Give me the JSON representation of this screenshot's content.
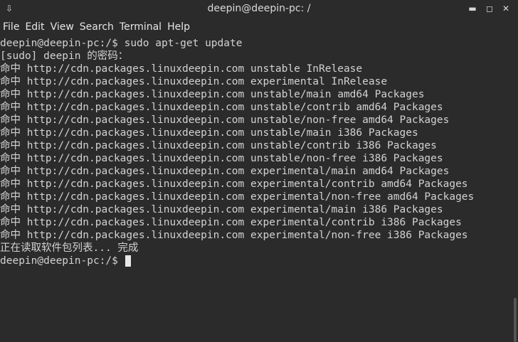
{
  "window": {
    "title": "deepin@deepin-pc: /",
    "menu_icon": "⇩",
    "min_glyph": "▬",
    "max_glyph": "◻",
    "close_glyph": "✕"
  },
  "menubar": {
    "items": [
      "File",
      "Edit",
      "View",
      "Search",
      "Terminal",
      "Help"
    ]
  },
  "terminal": {
    "lines": [
      "deepin@deepin-pc:/$ sudo apt-get update",
      "[sudo] deepin 的密码：",
      "命中 http://cdn.packages.linuxdeepin.com unstable InRelease",
      "命中 http://cdn.packages.linuxdeepin.com experimental InRelease",
      "命中 http://cdn.packages.linuxdeepin.com unstable/main amd64 Packages",
      "命中 http://cdn.packages.linuxdeepin.com unstable/contrib amd64 Packages",
      "命中 http://cdn.packages.linuxdeepin.com unstable/non-free amd64 Packages",
      "命中 http://cdn.packages.linuxdeepin.com unstable/main i386 Packages",
      "命中 http://cdn.packages.linuxdeepin.com unstable/contrib i386 Packages",
      "命中 http://cdn.packages.linuxdeepin.com unstable/non-free i386 Packages",
      "命中 http://cdn.packages.linuxdeepin.com experimental/main amd64 Packages",
      "命中 http://cdn.packages.linuxdeepin.com experimental/contrib amd64 Packages",
      "命中 http://cdn.packages.linuxdeepin.com experimental/non-free amd64 Packages",
      "命中 http://cdn.packages.linuxdeepin.com experimental/main i386 Packages",
      "命中 http://cdn.packages.linuxdeepin.com experimental/contrib i386 Packages",
      "命中 http://cdn.packages.linuxdeepin.com experimental/non-free i386 Packages",
      "正在读取软件包列表... 完成"
    ],
    "prompt": "deepin@deepin-pc:/$ "
  },
  "colors": {
    "background": "#2b2b2b",
    "text": "#d2d2d2",
    "cursor": "#e8e8e8"
  }
}
